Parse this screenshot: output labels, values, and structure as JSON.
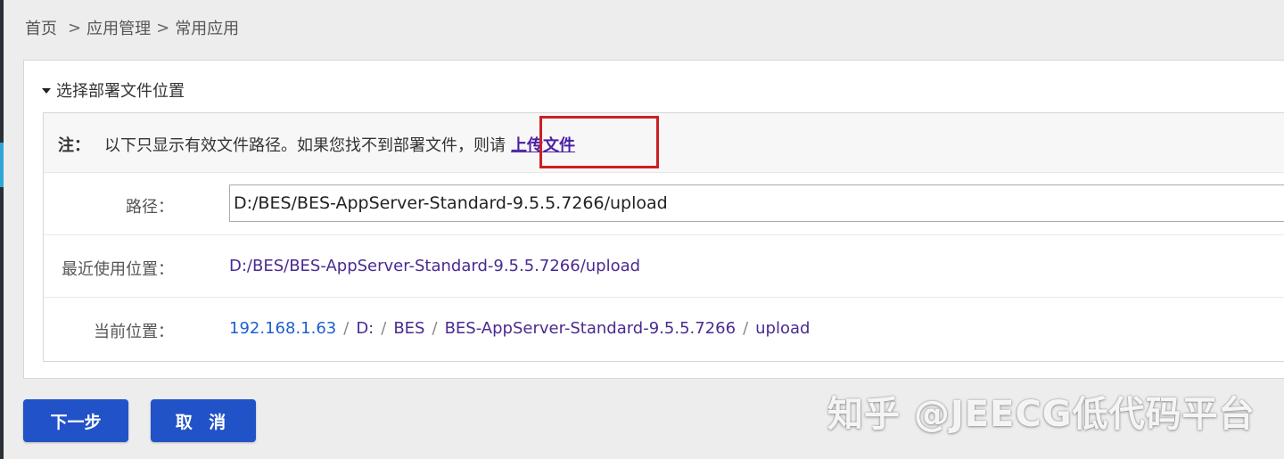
{
  "breadcrumb": {
    "home": "首页",
    "separator": ">",
    "section": "应用管理",
    "page": "常用应用"
  },
  "section": {
    "title": "选择部署文件位置"
  },
  "note": {
    "label": "注：",
    "text": "以下只显示有效文件路径。如果您找不到部署文件，则请",
    "upload_link": "上传文件"
  },
  "path": {
    "label": "路径：",
    "value": "D:/BES/BES-AppServer-Standard-9.5.5.7266/upload"
  },
  "recent": {
    "label": "最近使用位置：",
    "value": "D:/BES/BES-AppServer-Standard-9.5.5.7266/upload"
  },
  "current": {
    "label": "当前位置：",
    "separator": "/",
    "host": "192.168.1.63",
    "segments": [
      "D:",
      "BES",
      "BES-AppServer-Standard-9.5.5.7266",
      "upload"
    ]
  },
  "buttons": {
    "next": "下一步",
    "cancel": "取 消"
  },
  "watermark": "知乎 @JEECG低代码平台",
  "colors": {
    "primary_button": "#2152c7",
    "link": "#4a2a91",
    "host_link": "#1e5fd1",
    "highlight": "#cc1f24"
  }
}
